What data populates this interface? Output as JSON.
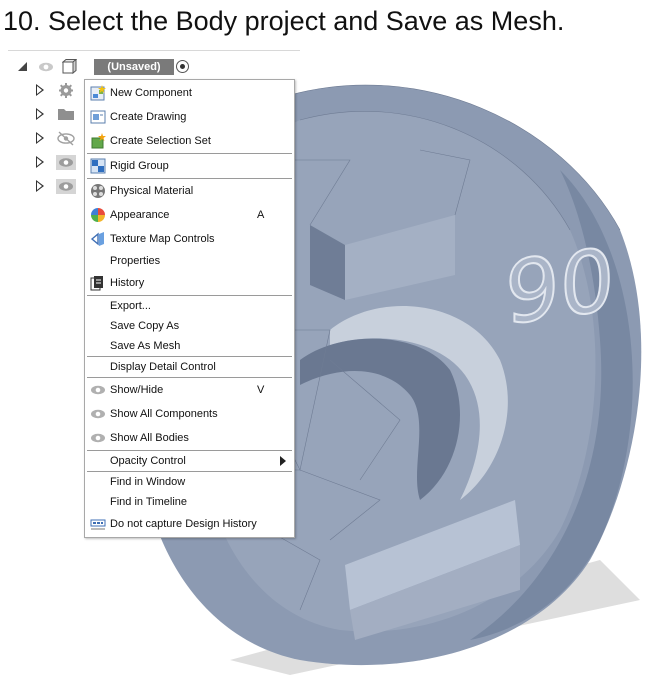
{
  "heading": "10. Select the Body project and Save as Mesh.",
  "tree": {
    "root_label": "(Unsaved)",
    "rows": [
      {
        "icon": "gear-icon"
      },
      {
        "icon": "folder-icon"
      },
      {
        "icon": "eye-hidden-icon"
      },
      {
        "icon": "eye-icon"
      },
      {
        "icon": "eye-icon"
      }
    ]
  },
  "model": {
    "numerals": "90"
  },
  "menu": {
    "new_component": "New Component",
    "create_drawing": "Create Drawing",
    "create_selection_set": "Create Selection Set",
    "rigid_group": "Rigid Group",
    "physical_material": "Physical Material",
    "appearance": "Appearance",
    "appearance_shortcut": "A",
    "texture_map_controls": "Texture Map Controls",
    "properties": "Properties",
    "history": "History",
    "export": "Export...",
    "save_copy_as": "Save Copy As",
    "save_as_mesh": "Save As Mesh",
    "display_detail_control": "Display Detail Control",
    "show_hide": "Show/Hide",
    "show_hide_shortcut": "V",
    "show_all_components": "Show All Components",
    "show_all_bodies": "Show All Bodies",
    "opacity_control": "Opacity Control",
    "find_in_window": "Find in Window",
    "find_in_timeline": "Find in Timeline",
    "no_design_history": "Do not capture Design History"
  },
  "colors": {
    "model_face": "#8c9ab2",
    "model_light": "#b9c4d6",
    "model_dark": "#5d6a82"
  }
}
